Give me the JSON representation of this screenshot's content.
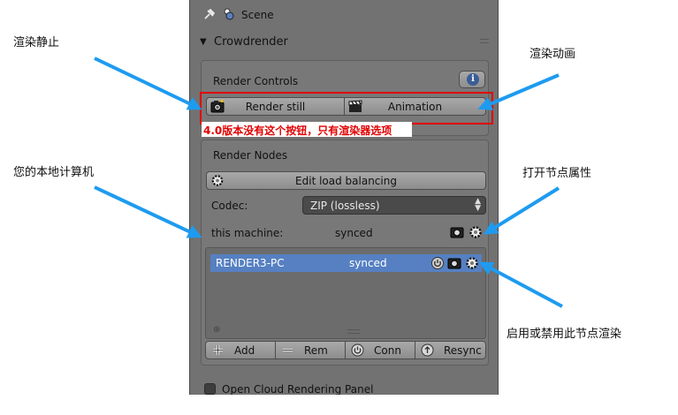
{
  "panel": {
    "scene_label": "Scene",
    "section_title": "Crowdrender",
    "render_controls": {
      "title": "Render Controls",
      "render_still_label": "Render still",
      "animation_label": "Animation"
    },
    "render_nodes": {
      "title": "Render Nodes",
      "edit_load_balancing_label": "Edit load balancing",
      "codec_label": "Codec:",
      "codec_value": "ZIP (lossless)",
      "this_machine_label": "this machine:",
      "this_machine_status": "synced",
      "nodes": [
        {
          "name": "RENDER3-PC",
          "status": "synced"
        }
      ],
      "toolbar": {
        "add_label": "Add",
        "rem_label": "Rem",
        "conn_label": "Conn",
        "resync_label": "Resync"
      }
    },
    "open_cloud_label": "Open Cloud Rendering Panel"
  },
  "annotations": {
    "render_still": "渲染静止",
    "render_animation": "渲染动画",
    "version_note": "4.0版本没有这个按钮，只有渲染器选项",
    "local_machine": "您的本地计算机",
    "node_properties": "打开节点属性",
    "enable_node": "启用或禁用此节点渲染"
  },
  "colors": {
    "panel_bg": "#727272",
    "selected_row": "#5680c2",
    "arrow": "#1e9bf0",
    "highlight": "#e00000"
  }
}
